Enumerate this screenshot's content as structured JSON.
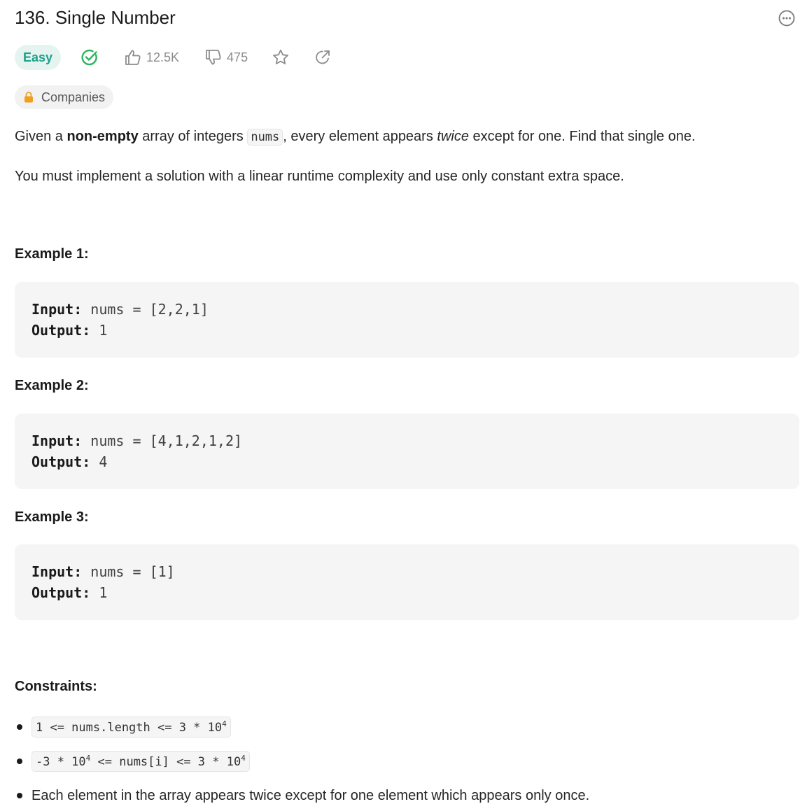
{
  "problem": {
    "title": "136. Single Number",
    "difficulty": "Easy",
    "likes": "12.5K",
    "dislikes": "475",
    "companies_label": "Companies"
  },
  "description": {
    "p1_part1": "Given a ",
    "p1_bold": "non-empty",
    "p1_part2": " array of integers ",
    "p1_code": "nums",
    "p1_part3": ", every element appears ",
    "p1_italic": "twice",
    "p1_part4": " except for one. Find that single one.",
    "p2": "You must implement a solution with a linear runtime complexity and use only constant extra space."
  },
  "labels": {
    "input": "Input:",
    "output": "Output:"
  },
  "examples": [
    {
      "title": "Example 1:",
      "input": " nums = [2,2,1]",
      "output": " 1"
    },
    {
      "title": "Example 2:",
      "input": " nums = [4,1,2,1,2]",
      "output": " 4"
    },
    {
      "title": "Example 3:",
      "input": " nums = [1]",
      "output": " 1"
    }
  ],
  "constraints": {
    "title": "Constraints:",
    "c1_pre": "1 <= nums.length <= 3 * 10",
    "c1_sup": "4",
    "c2_pre": "-3 * 10",
    "c2_sup1": "4",
    "c2_mid": " <= nums[i] <= 3 * 10",
    "c2_sup2": "4",
    "c3": "Each element in the array appears twice except for one element which appears only once."
  },
  "colors": {
    "easy_text": "#1fa08b",
    "easy_bg": "#e6f4f1",
    "solved_check": "#2db55d",
    "muted_icon": "#8c8c8c",
    "lock": "#f0a020"
  }
}
